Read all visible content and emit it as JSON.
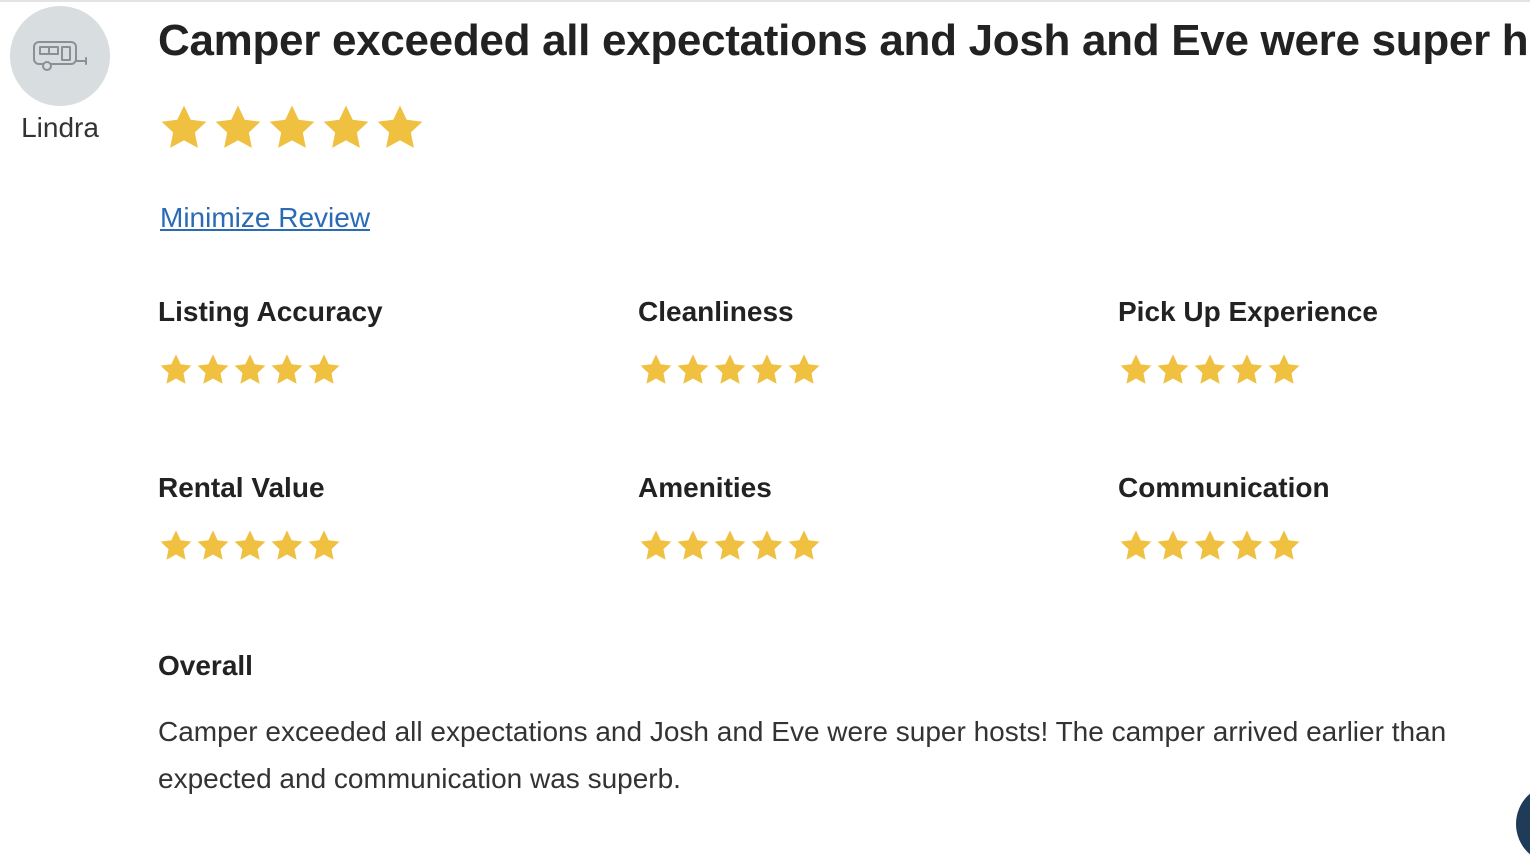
{
  "review": {
    "reviewer_name": "Lindra",
    "avatar_icon": "camper-trailer-icon",
    "title": "Camper exceeded all expectations and Josh and Eve were super hosts!",
    "overall_rating": 5,
    "rating_max": 5,
    "minimize_label": "Minimize Review",
    "categories": [
      {
        "label": "Listing Accuracy",
        "rating": 5
      },
      {
        "label": "Cleanliness",
        "rating": 5
      },
      {
        "label": "Pick Up Experience",
        "rating": 5
      },
      {
        "label": "Rental Value",
        "rating": 5
      },
      {
        "label": "Amenities",
        "rating": 5
      },
      {
        "label": "Communication",
        "rating": 5
      }
    ],
    "overall_label": "Overall",
    "overall_text": "Camper exceeded all expectations and Josh and Eve were super hosts! The camper arrived earlier than expected and communication was superb."
  },
  "colors": {
    "star": "#f0c040",
    "link": "#2a6bb5",
    "avatar_bg": "#d8dde0"
  }
}
